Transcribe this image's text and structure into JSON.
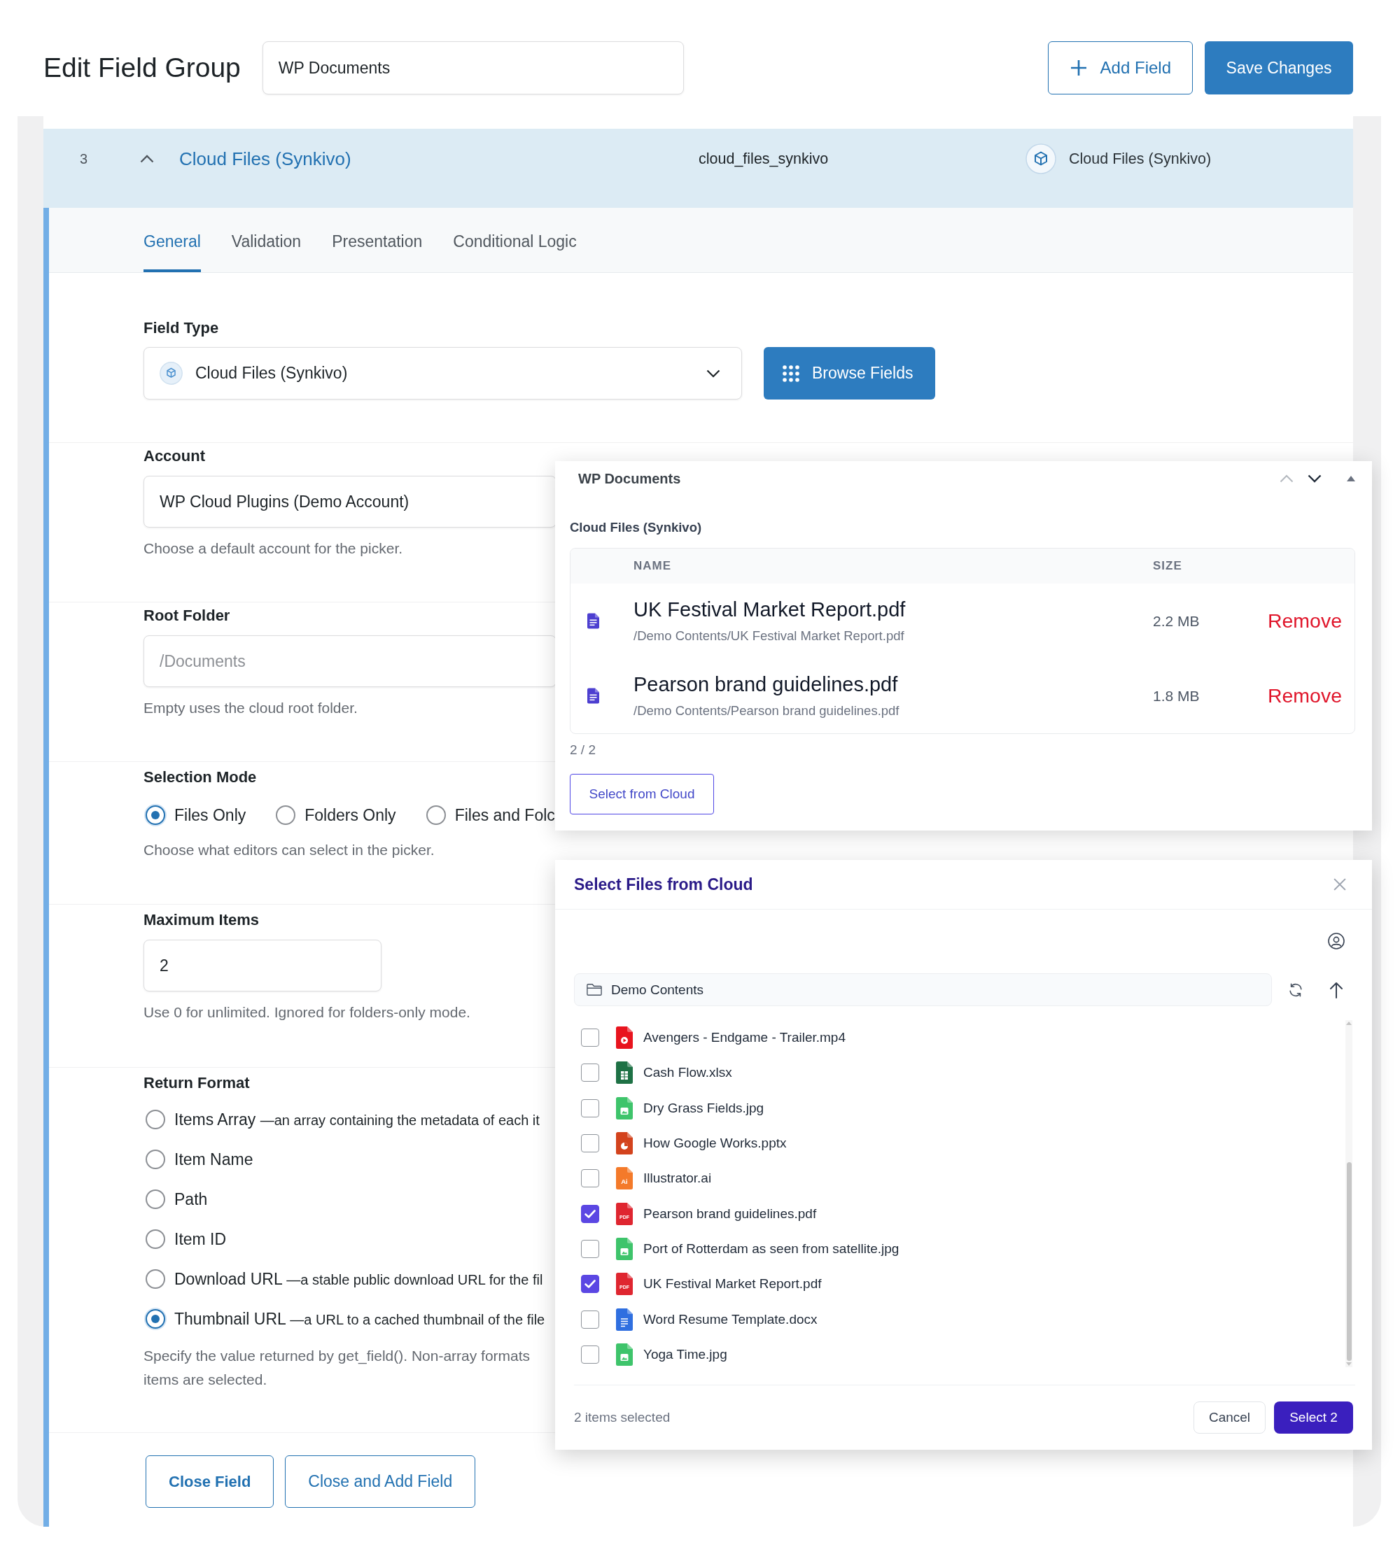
{
  "header": {
    "title": "Edit Field Group",
    "group_name": "WP Documents",
    "add_button": "Add Field",
    "save_button": "Save Changes"
  },
  "field_row": {
    "order": "3",
    "expanded": true,
    "label": "Cloud Files (Synkivo)",
    "name": "cloud_files_synkivo",
    "type": "Cloud Files (Synkivo)"
  },
  "tabs": [
    {
      "label": "General",
      "selected": true
    },
    {
      "label": "Validation",
      "selected": false
    },
    {
      "label": "Presentation",
      "selected": false
    },
    {
      "label": "Conditional Logic",
      "selected": false
    }
  ],
  "sections": [
    {
      "kind": "select",
      "label": "Field Type",
      "value": "Cloud Files (Synkivo)",
      "button": "Browse Fields"
    },
    {
      "kind": "text",
      "label": "Account",
      "value": "WP Cloud Plugins (Demo Account)",
      "help": "Choose a default account for the picker."
    },
    {
      "kind": "text",
      "label": "Root Folder",
      "placeholder": "/Documents",
      "help": "Empty uses the cloud root folder."
    },
    {
      "kind": "radio_row",
      "label": "Selection Mode",
      "options": [
        {
          "label": "Files Only",
          "selected": true
        },
        {
          "label": "Folders Only",
          "selected": false
        },
        {
          "label": "Files and Folc",
          "selected": false
        }
      ],
      "help": "Choose what editors can select in the picker."
    },
    {
      "kind": "number",
      "label": "Maximum Items",
      "value": "2",
      "help": "Use 0 for unlimited. Ignored for folders-only mode."
    },
    {
      "kind": "radio_list",
      "label": "Return Format",
      "options": [
        {
          "label": "Items Array",
          "description": "—an array containing the metadata of each it",
          "selected": false
        },
        {
          "label": "Item Name",
          "selected": false
        },
        {
          "label": "Path",
          "selected": false
        },
        {
          "label": "Item ID",
          "selected": false
        },
        {
          "label": "Download URL",
          "description": "—a stable public download URL for the fil",
          "selected": false
        },
        {
          "label": "Thumbnail URL",
          "description": "—a URL to a cached thumbnail of the file",
          "selected": true
        }
      ],
      "help_lines": [
        "Specify the value returned by get_field(). Non-array formats",
        "items are selected."
      ]
    }
  ],
  "footer_buttons": [
    {
      "label": "Close Field",
      "kind": "primary"
    },
    {
      "label": "Close and Add Field",
      "kind": "secondary"
    }
  ],
  "preview_panel": {
    "title": "WP Documents",
    "field_label": "Cloud Files (Synkivo)",
    "columns": [
      "NAME",
      "SIZE"
    ],
    "files": [
      {
        "name": "UK Festival Market Report.pdf",
        "path": "/Demo Contents/UK Festival Market Report.pdf",
        "size": "2.2 MB",
        "action": "Remove"
      },
      {
        "name": "Pearson brand guidelines.pdf",
        "path": "/Demo Contents/Pearson brand guidelines.pdf",
        "size": "1.8 MB",
        "action": "Remove"
      }
    ],
    "count": "2 / 2",
    "button": "Select from Cloud"
  },
  "picker_dialog": {
    "title": "Select Files from Cloud",
    "folder": "Demo Contents",
    "items": [
      {
        "name": "Avengers - Endgame - Trailer.mp4",
        "kind": "video",
        "checked": false
      },
      {
        "name": "Cash Flow.xlsx",
        "kind": "sheet",
        "checked": false
      },
      {
        "name": "Dry Grass Fields.jpg",
        "kind": "image",
        "checked": false
      },
      {
        "name": "How Google Works.pptx",
        "kind": "slides",
        "checked": false
      },
      {
        "name": "Illustrator.ai",
        "kind": "illustrator",
        "icon_text": "Ai",
        "checked": false
      },
      {
        "name": "Pearson brand guidelines.pdf",
        "kind": "pdf",
        "icon_text": "PDF",
        "checked": true
      },
      {
        "name": "Port of Rotterdam as seen from satellite.jpg",
        "kind": "image",
        "checked": false
      },
      {
        "name": "UK Festival Market Report.pdf",
        "kind": "pdf",
        "icon_text": "PDF",
        "checked": true
      },
      {
        "name": "Word Resume Template.docx",
        "kind": "doc",
        "checked": false
      },
      {
        "name": "Yoga Time.jpg",
        "kind": "image",
        "checked": false
      }
    ],
    "status": "2 items selected",
    "cancel": "Cancel",
    "confirm": "Select 2"
  }
}
